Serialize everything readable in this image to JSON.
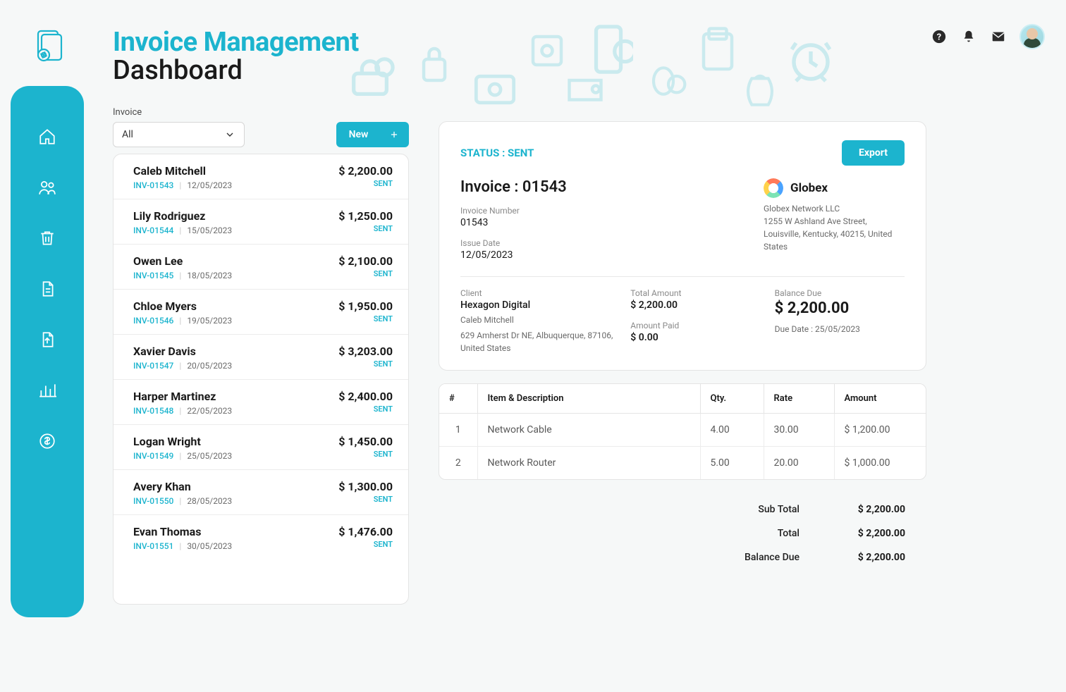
{
  "header": {
    "title_line1": "Invoice Management",
    "title_line2": "Dashboard"
  },
  "filter": {
    "label": "Invoice",
    "selected": "All"
  },
  "buttons": {
    "new": "New",
    "export": "Export"
  },
  "invoices": [
    {
      "name": "Caleb Mitchell",
      "inv": "INV-01543",
      "date": "12/05/2023",
      "amount": "$ 2,200.00",
      "status": "SENT"
    },
    {
      "name": "Lily Rodriguez",
      "inv": "INV-01544",
      "date": "15/05/2023",
      "amount": "$ 1,250.00",
      "status": "SENT"
    },
    {
      "name": "Owen Lee",
      "inv": "INV-01545",
      "date": "18/05/2023",
      "amount": "$ 2,100.00",
      "status": "SENT"
    },
    {
      "name": "Chloe Myers",
      "inv": "INV-01546",
      "date": "19/05/2023",
      "amount": "$ 1,950.00",
      "status": "SENT"
    },
    {
      "name": "Xavier Davis",
      "inv": "INV-01547",
      "date": "20/05/2023",
      "amount": "$ 3,203.00",
      "status": "SENT"
    },
    {
      "name": "Harper Martinez",
      "inv": "INV-01548",
      "date": "22/05/2023",
      "amount": "$ 2,400.00",
      "status": "SENT"
    },
    {
      "name": "Logan Wright",
      "inv": "INV-01549",
      "date": "25/05/2023",
      "amount": "$ 1,450.00",
      "status": "SENT"
    },
    {
      "name": "Avery Khan",
      "inv": "INV-01550",
      "date": "28/05/2023",
      "amount": "$ 1,300.00",
      "status": "SENT"
    },
    {
      "name": "Evan Thomas",
      "inv": "INV-01551",
      "date": "30/05/2023",
      "amount": "$ 1,476.00",
      "status": "SENT"
    }
  ],
  "detail": {
    "status_text": "STATUS : SENT",
    "invoice_title": "Invoice : 01543",
    "invoice_number_label": "Invoice Number",
    "invoice_number": "01543",
    "issue_date_label": "Issue Date",
    "issue_date": "12/05/2023",
    "company": {
      "name": "Globex",
      "legal": "Globex Network LLC",
      "addr": "1255 W Ashland Ave Street, Louisville, Kentucky, 40215, United States"
    },
    "client": {
      "label": "Client",
      "company": "Hexagon Digital",
      "contact": "Caleb Mitchell",
      "addr": "629 Amherst Dr NE, Albuquerque, 87106, United States"
    },
    "totals_block": {
      "total_amount_label": "Total Amount",
      "total_amount": "$ 2,200.00",
      "amount_paid_label": "Amount Paid",
      "amount_paid": "$ 0.00",
      "balance_due_label": "Balance Due",
      "balance_due": "$ 2,200.00",
      "due_date_text": "Due Date : 25/05/2023"
    }
  },
  "items_table": {
    "headers": {
      "num": "#",
      "desc": "Item & Description",
      "qty": "Qty.",
      "rate": "Rate",
      "amount": "Amount"
    },
    "rows": [
      {
        "num": "1",
        "desc": "Network Cable",
        "qty": "4.00",
        "rate": "30.00",
        "amount": "$ 1,200.00"
      },
      {
        "num": "2",
        "desc": "Network Router",
        "qty": "5.00",
        "rate": "20.00",
        "amount": "$ 1,000.00"
      }
    ]
  },
  "totals": {
    "subtotal_label": "Sub Total",
    "subtotal": "$ 2,200.00",
    "total_label": "Total",
    "total": "$ 2,200.00",
    "balance_label": "Balance Due",
    "balance": "$ 2,200.00"
  }
}
